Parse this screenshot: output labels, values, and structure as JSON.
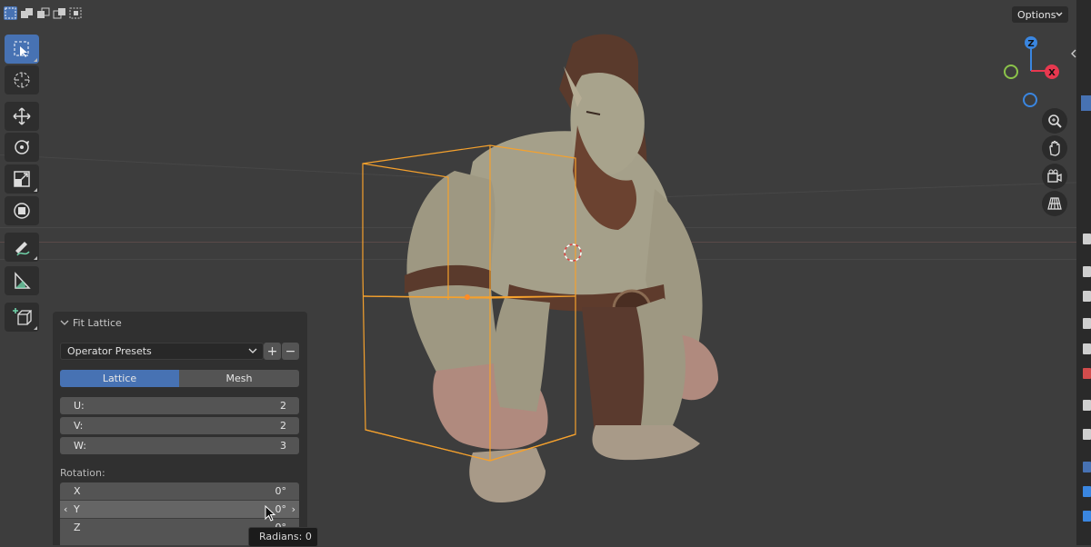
{
  "header": {
    "options_label": "Options"
  },
  "toolbar": {
    "tools": [
      "select-box",
      "cursor",
      "move",
      "rotate",
      "scale",
      "transform",
      "annotate",
      "measure",
      "add-cube"
    ],
    "active_tool": "select-box"
  },
  "panel": {
    "title": "Fit Lattice",
    "presets_label": "Operator Presets",
    "add_label": "+",
    "remove_label": "−",
    "mode_tabs": [
      "Lattice",
      "Mesh"
    ],
    "active_tab": "Lattice",
    "fields": [
      {
        "label": "U:",
        "value": "2"
      },
      {
        "label": "V:",
        "value": "2"
      },
      {
        "label": "W:",
        "value": "3"
      }
    ],
    "rotation_label": "Rotation:",
    "rotation": [
      {
        "label": "X",
        "value": "0°"
      },
      {
        "label": "Y",
        "value": "0°"
      },
      {
        "label": "Z",
        "value": "0°"
      }
    ]
  },
  "tooltip": {
    "text": "Radians: 0"
  },
  "gizmo": {
    "axes": [
      "Z",
      "X"
    ],
    "colors": {
      "x": "#e8384f",
      "y": "#8bc34a",
      "z": "#3a86e0"
    }
  },
  "colors": {
    "accent": "#4772b3",
    "lattice": "#f5a12d",
    "viewport": "#3d3d3d"
  }
}
